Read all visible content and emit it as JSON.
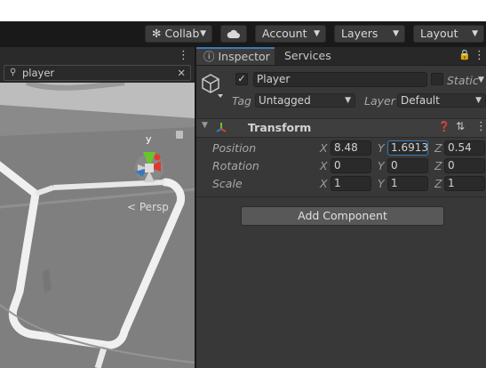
{
  "toolbar": {
    "collab_label": "Collab",
    "collab_icon": "collab-icon",
    "cloud_icon": "cloud-icon",
    "account_label": "Account",
    "layers_label": "Layers",
    "layout_label": "Layout"
  },
  "scene": {
    "search_value": "player",
    "search_icon": "search-icon",
    "persp_label": "Persp",
    "gizmo_labels": {
      "y": "y"
    }
  },
  "inspector": {
    "tabs": [
      {
        "label": "Inspector",
        "icon": "info-icon",
        "active": true
      },
      {
        "label": "Services",
        "active": false
      }
    ],
    "gameobject": {
      "active": true,
      "name": "Player",
      "static_label": "Static",
      "static_checked": false,
      "tag_label": "Tag",
      "tag_value": "Untagged",
      "layer_label": "Layer",
      "layer_value": "Default"
    },
    "transform": {
      "title": "Transform",
      "rows": [
        {
          "label": "Position",
          "x": "8.48",
          "y": "1.69131",
          "z": "0.54"
        },
        {
          "label": "Rotation",
          "x": "0",
          "y": "0",
          "z": "0"
        },
        {
          "label": "Scale",
          "x": "1",
          "y": "1",
          "z": "1"
        }
      ],
      "axis_labels": {
        "x": "X",
        "y": "Y",
        "z": "Z"
      }
    },
    "add_component_label": "Add Component"
  },
  "colors": {
    "accent": "#3a79bb",
    "panel": "#383838",
    "toolbar": "#191919",
    "gizmo_y": "#6ac52b",
    "gizmo_x": "#e23a2a"
  }
}
